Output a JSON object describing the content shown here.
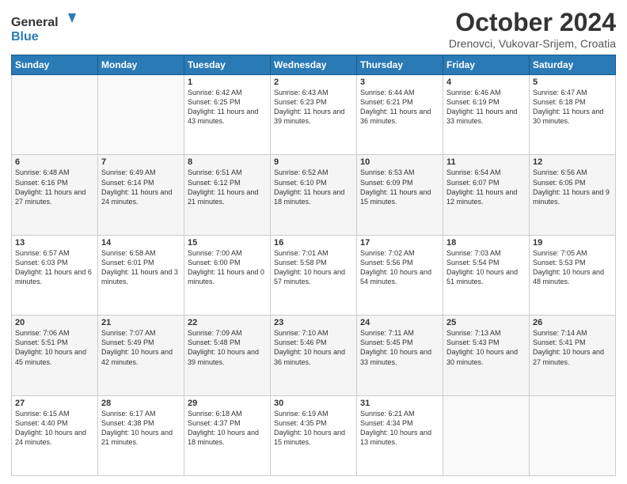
{
  "header": {
    "logo_general": "General",
    "logo_blue": "Blue",
    "month_title": "October 2024",
    "location": "Drenovci, Vukovar-Srijem, Croatia"
  },
  "weekdays": [
    "Sunday",
    "Monday",
    "Tuesday",
    "Wednesday",
    "Thursday",
    "Friday",
    "Saturday"
  ],
  "weeks": [
    [
      {
        "day": "",
        "info": ""
      },
      {
        "day": "",
        "info": ""
      },
      {
        "day": "1",
        "info": "Sunrise: 6:42 AM\nSunset: 6:25 PM\nDaylight: 11 hours and 43 minutes."
      },
      {
        "day": "2",
        "info": "Sunrise: 6:43 AM\nSunset: 6:23 PM\nDaylight: 11 hours and 39 minutes."
      },
      {
        "day": "3",
        "info": "Sunrise: 6:44 AM\nSunset: 6:21 PM\nDaylight: 11 hours and 36 minutes."
      },
      {
        "day": "4",
        "info": "Sunrise: 6:46 AM\nSunset: 6:19 PM\nDaylight: 11 hours and 33 minutes."
      },
      {
        "day": "5",
        "info": "Sunrise: 6:47 AM\nSunset: 6:18 PM\nDaylight: 11 hours and 30 minutes."
      }
    ],
    [
      {
        "day": "6",
        "info": "Sunrise: 6:48 AM\nSunset: 6:16 PM\nDaylight: 11 hours and 27 minutes."
      },
      {
        "day": "7",
        "info": "Sunrise: 6:49 AM\nSunset: 6:14 PM\nDaylight: 11 hours and 24 minutes."
      },
      {
        "day": "8",
        "info": "Sunrise: 6:51 AM\nSunset: 6:12 PM\nDaylight: 11 hours and 21 minutes."
      },
      {
        "day": "9",
        "info": "Sunrise: 6:52 AM\nSunset: 6:10 PM\nDaylight: 11 hours and 18 minutes."
      },
      {
        "day": "10",
        "info": "Sunrise: 6:53 AM\nSunset: 6:09 PM\nDaylight: 11 hours and 15 minutes."
      },
      {
        "day": "11",
        "info": "Sunrise: 6:54 AM\nSunset: 6:07 PM\nDaylight: 11 hours and 12 minutes."
      },
      {
        "day": "12",
        "info": "Sunrise: 6:56 AM\nSunset: 6:05 PM\nDaylight: 11 hours and 9 minutes."
      }
    ],
    [
      {
        "day": "13",
        "info": "Sunrise: 6:57 AM\nSunset: 6:03 PM\nDaylight: 11 hours and 6 minutes."
      },
      {
        "day": "14",
        "info": "Sunrise: 6:58 AM\nSunset: 6:01 PM\nDaylight: 11 hours and 3 minutes."
      },
      {
        "day": "15",
        "info": "Sunrise: 7:00 AM\nSunset: 6:00 PM\nDaylight: 11 hours and 0 minutes."
      },
      {
        "day": "16",
        "info": "Sunrise: 7:01 AM\nSunset: 5:58 PM\nDaylight: 10 hours and 57 minutes."
      },
      {
        "day": "17",
        "info": "Sunrise: 7:02 AM\nSunset: 5:56 PM\nDaylight: 10 hours and 54 minutes."
      },
      {
        "day": "18",
        "info": "Sunrise: 7:03 AM\nSunset: 5:54 PM\nDaylight: 10 hours and 51 minutes."
      },
      {
        "day": "19",
        "info": "Sunrise: 7:05 AM\nSunset: 5:53 PM\nDaylight: 10 hours and 48 minutes."
      }
    ],
    [
      {
        "day": "20",
        "info": "Sunrise: 7:06 AM\nSunset: 5:51 PM\nDaylight: 10 hours and 45 minutes."
      },
      {
        "day": "21",
        "info": "Sunrise: 7:07 AM\nSunset: 5:49 PM\nDaylight: 10 hours and 42 minutes."
      },
      {
        "day": "22",
        "info": "Sunrise: 7:09 AM\nSunset: 5:48 PM\nDaylight: 10 hours and 39 minutes."
      },
      {
        "day": "23",
        "info": "Sunrise: 7:10 AM\nSunset: 5:46 PM\nDaylight: 10 hours and 36 minutes."
      },
      {
        "day": "24",
        "info": "Sunrise: 7:11 AM\nSunset: 5:45 PM\nDaylight: 10 hours and 33 minutes."
      },
      {
        "day": "25",
        "info": "Sunrise: 7:13 AM\nSunset: 5:43 PM\nDaylight: 10 hours and 30 minutes."
      },
      {
        "day": "26",
        "info": "Sunrise: 7:14 AM\nSunset: 5:41 PM\nDaylight: 10 hours and 27 minutes."
      }
    ],
    [
      {
        "day": "27",
        "info": "Sunrise: 6:15 AM\nSunset: 4:40 PM\nDaylight: 10 hours and 24 minutes."
      },
      {
        "day": "28",
        "info": "Sunrise: 6:17 AM\nSunset: 4:38 PM\nDaylight: 10 hours and 21 minutes."
      },
      {
        "day": "29",
        "info": "Sunrise: 6:18 AM\nSunset: 4:37 PM\nDaylight: 10 hours and 18 minutes."
      },
      {
        "day": "30",
        "info": "Sunrise: 6:19 AM\nSunset: 4:35 PM\nDaylight: 10 hours and 15 minutes."
      },
      {
        "day": "31",
        "info": "Sunrise: 6:21 AM\nSunset: 4:34 PM\nDaylight: 10 hours and 13 minutes."
      },
      {
        "day": "",
        "info": ""
      },
      {
        "day": "",
        "info": ""
      }
    ]
  ]
}
